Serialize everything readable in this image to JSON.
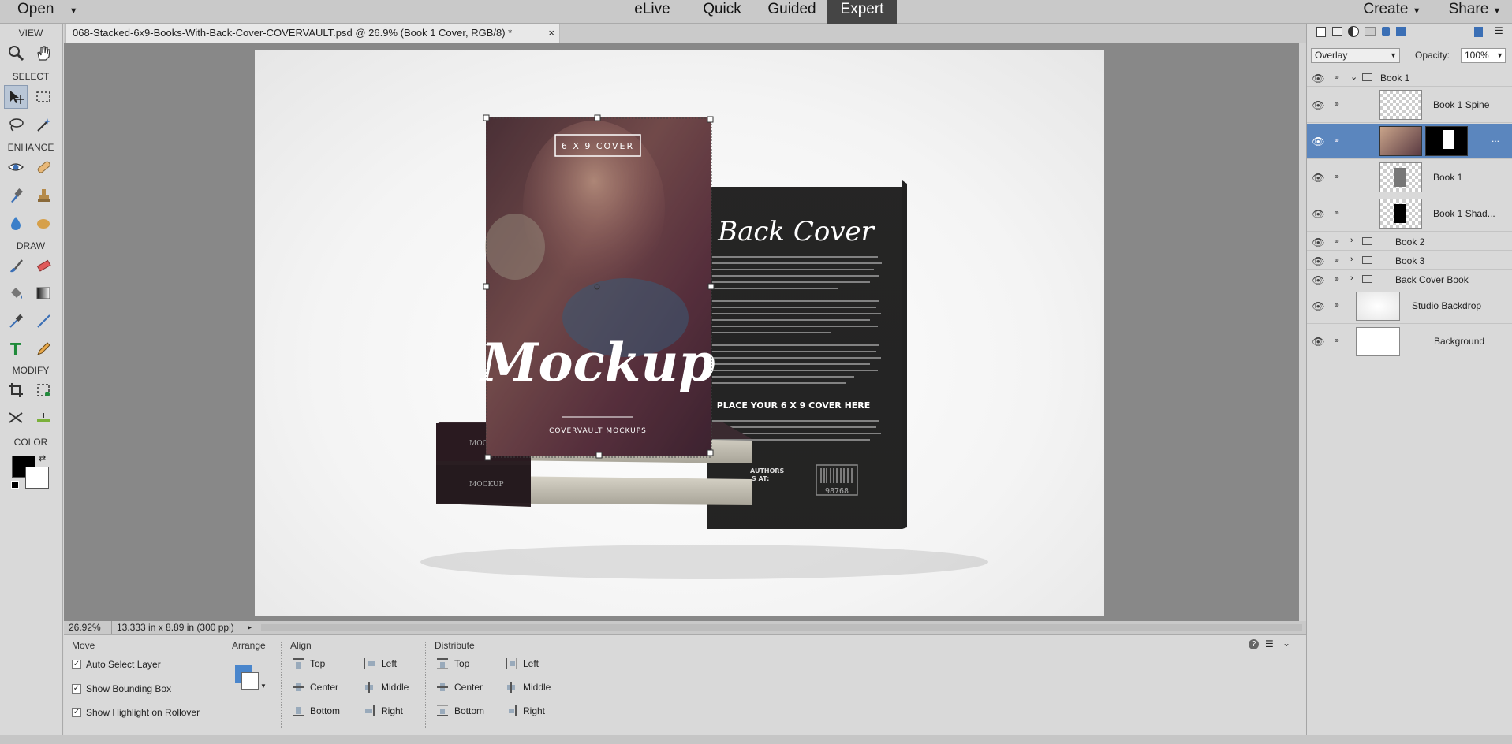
{
  "menu": {
    "open": "Open",
    "create": "Create",
    "share": "Share"
  },
  "modes": [
    "eLive",
    "Quick",
    "Guided",
    "Expert"
  ],
  "toolbox": {
    "view": "VIEW",
    "select": "SELECT",
    "enhance": "ENHANCE",
    "draw": "DRAW",
    "modify": "MODIFY",
    "color": "COLOR"
  },
  "document": {
    "tab_title": "068-Stacked-6x9-Books-With-Back-Cover-COVERVAULT.psd @ 26.9% (Book 1 Cover, RGB/8) *",
    "close": "×"
  },
  "artwork": {
    "front_badge": "6 X 9 COVER",
    "front_title": "Mockup",
    "front_sub": "COVERVAULT MOCKUPS",
    "back_title": "Back Cover",
    "back_cta": "PLACE YOUR 6 X 9 COVER HERE",
    "back_authors": "AUTHORS",
    "back_at": "S AT:",
    "barcode_num": "98768",
    "spine_text": "MOCKUP"
  },
  "status": {
    "zoom": "26.92%",
    "size": "13.333 in x 8.89 in (300 ppi)"
  },
  "options": {
    "move": "Move",
    "auto_select": "Auto Select Layer",
    "show_bounding": "Show Bounding Box",
    "show_highlight": "Show Highlight on Rollover",
    "arrange": "Arrange",
    "align": "Align",
    "distribute": "Distribute",
    "top": "Top",
    "center": "Center",
    "bottom": "Bottom",
    "left": "Left",
    "middle": "Middle",
    "right": "Right"
  },
  "layers_panel": {
    "blend_mode": "Overlay",
    "opacity_label": "Opacity:",
    "opacity_value": "100%",
    "more": "...",
    "layers": [
      "Book 1",
      "Book 1 Spine",
      "Book 1 Shad...",
      "Book 2",
      "Book 3",
      "Back Cover Book",
      "Studio Backdrop",
      "Background"
    ],
    "selected_layer": "Book 1 Cover"
  },
  "colors": {
    "accent": "#5b86be",
    "active_mode": "#454545",
    "canvas": "#888888"
  }
}
